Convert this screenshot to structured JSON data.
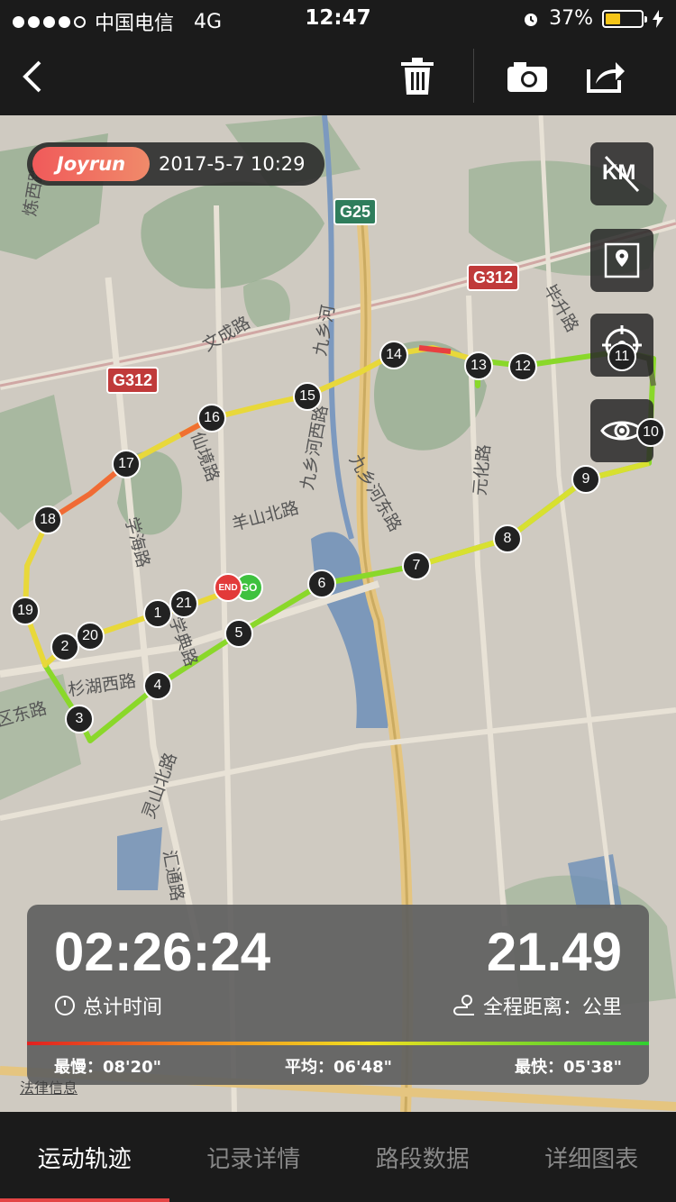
{
  "status_bar": {
    "carrier": "中国电信",
    "network": "4G",
    "time": "12:47",
    "battery": "37%",
    "battery_level": 0.37
  },
  "toolbar": {
    "back_icon": "chevron-left-icon",
    "delete_icon": "trash-icon",
    "camera_icon": "camera-icon",
    "share_icon": "share-icon"
  },
  "map": {
    "brand": "Joyrun",
    "datetime": "2017-5-7 10:29",
    "side_buttons": [
      "km-toggle-icon",
      "map-layer-icon",
      "locate-icon",
      "eye-icon"
    ],
    "km_label": "KM",
    "legal_link": "法律信息",
    "road_labels": {
      "wencheng": "文成路",
      "jiuxianghe": "九乡河",
      "jiuxianghe_east": "九乡河东路",
      "jiuxianghe_west": "九乡河西路",
      "xianyin": "仙境路",
      "yangshan_north": "羊山北路",
      "xuehai": "学海路",
      "xuedian": "学典路",
      "shanhu_west": "杉湖西路",
      "lingshan_north": "灵山北路",
      "huitong": "汇通路",
      "yuanhua": "元化路",
      "bisheng": "毕升路",
      "lian_west": "炼西路",
      "east_road": "区东路"
    },
    "shields": {
      "g25": "G25",
      "g312_top": "G312",
      "g312_left": "G312"
    },
    "markers": [
      "1",
      "2",
      "3",
      "4",
      "5",
      "6",
      "7",
      "8",
      "9",
      "10",
      "11",
      "12",
      "13",
      "14",
      "15",
      "16",
      "17",
      "18",
      "19",
      "20",
      "21"
    ],
    "end_label": "END",
    "go_label": "GO"
  },
  "stats": {
    "total_time": "02:26:24",
    "total_time_label": "总计时间",
    "distance": "21.49",
    "distance_label": "全程距离：公里",
    "slowest": "最慢：08'20\"",
    "average": "平均：06'48\"",
    "fastest": "最快：05'38\""
  },
  "tabs": [
    {
      "label": "运动轨迹",
      "active": true
    },
    {
      "label": "记录详情",
      "active": false
    },
    {
      "label": "路段数据",
      "active": false
    },
    {
      "label": "详细图表",
      "active": false
    }
  ]
}
